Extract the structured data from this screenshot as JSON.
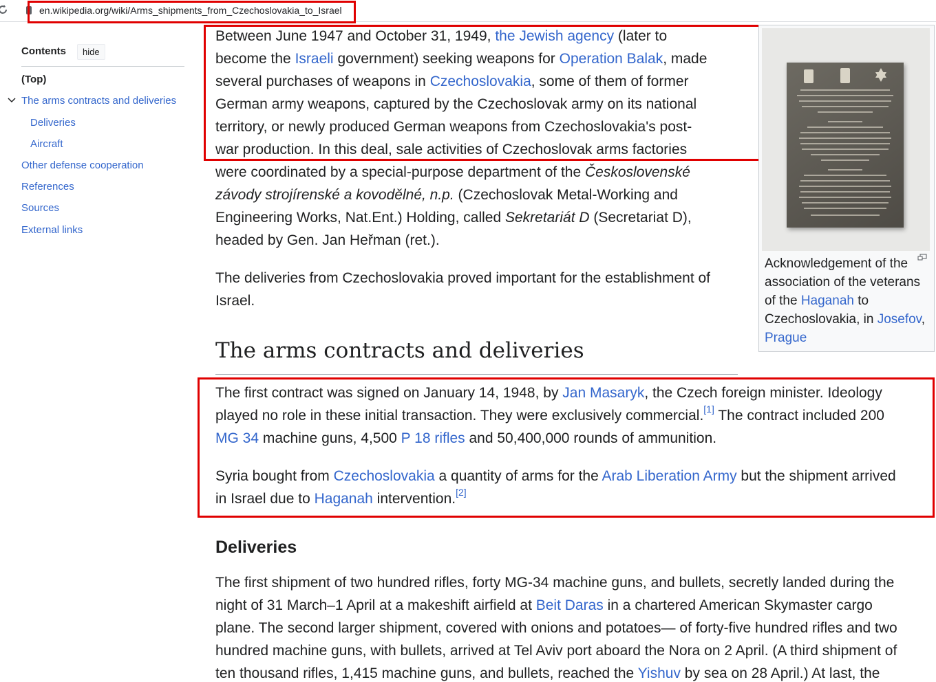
{
  "browser": {
    "url": "en.wikipedia.org/wiki/Arms_shipments_from_Czechoslovakia_to_Israel"
  },
  "toc": {
    "title": "Contents",
    "hide_label": "hide",
    "items": [
      {
        "label": "(Top)"
      },
      {
        "label": "The arms contracts and deliveries"
      },
      {
        "label": "Deliveries"
      },
      {
        "label": "Aircraft"
      },
      {
        "label": "Other defense cooperation"
      },
      {
        "label": "References"
      },
      {
        "label": "Sources"
      },
      {
        "label": "External links"
      }
    ]
  },
  "intro": {
    "l1a": "Between June 1947 and October 31, 1949, ",
    "l1_link": "the Jewish agency",
    "l1b": " (later to",
    "l2a": "become the ",
    "l2_link1": "Israeli",
    "l2b": " government) seeking weapons for ",
    "l2_link2": "Operation Balak",
    "l2c": ", made",
    "l3a": "several purchases of weapons in ",
    "l3_link": "Czechoslovakia",
    "l3b": ", some of them of former",
    "l4": "German army weapons, captured by the Czechoslovak army on its national",
    "l5": "territory, or newly produced German weapons from Czechoslovakia's post-",
    "l6": "war production. In this deal, sale activities of Czechoslovak arms factories",
    "l7a": "were coordinated by a special-purpose department of the ",
    "l7_italic": "Československé",
    "l8_italic": "závody strojírenské a kovodělné, n.p.",
    "l8b": " (Czechoslovak Metal-Working and",
    "l9a": "Engineering Works, Nat.Ent.) Holding, called ",
    "l9_italic": "Sekretariát D",
    "l9b": " (Secretariat D),",
    "l10": "headed by Gen. Jan Heřman (ret.).",
    "p2_l1": "The deliveries from Czechoslovakia proved important for the establishment of",
    "p2_l2": "Israel."
  },
  "section_arms": {
    "heading": "The arms contracts and deliveries",
    "p1_l1a": "The first contract was signed on January 14, 1948, by ",
    "p1_l1_link": "Jan Masaryk",
    "p1_l1b": ", the Czech foreign minister. Ideology",
    "p1_l2a": "played no role in these initial transaction. They were exclusively commercial.",
    "p1_l2_ref": "[1]",
    "p1_l2b": " The contract included 200",
    "p1_l3_link1": "MG 34",
    "p1_l3a": " machine guns, 4,500 ",
    "p1_l3_link2": "P 18 rifles",
    "p1_l3b": " and 50,400,000 rounds of ammunition.",
    "p2_l1a": "Syria bought from ",
    "p2_l1_link1": "Czechoslovakia",
    "p2_l1b": " a quantity of arms for the ",
    "p2_l1_link2": "Arab Liberation Army",
    "p2_l1c": " but the shipment arrived",
    "p2_l2a": "in Israel due to ",
    "p2_l2_link": "Haganah",
    "p2_l2b": " intervention.",
    "p2_l2_ref": "[2]"
  },
  "section_deliveries": {
    "heading": "Deliveries",
    "l1": "The first shipment of two hundred rifles, forty MG-34 machine guns, and bullets, secretly landed during the",
    "l2a": "night of 31 March–1 April at a makeshift airfield at ",
    "l2_link": "Beit Daras",
    "l2b": " in a chartered American Skymaster cargo",
    "l3": "plane. The second larger shipment, covered with onions and potatoes— of forty-five hundred rifles and two",
    "l4": "hundred machine guns, with bullets, arrived at Tel Aviv port aboard the Nora on 2 April. (A third shipment of",
    "l5a": "ten thousand rifles, 1,415 machine guns, and bullets, reached the ",
    "l5_link": "Yishuv",
    "l5b": " by sea on 28 April.) At last, the"
  },
  "figure": {
    "caption_a": "Acknowledgement of the association of the veterans of the ",
    "caption_link1": "Haganah",
    "caption_b": " to Czechoslovakia, in ",
    "caption_link2": "Josefov",
    "caption_c": ", ",
    "caption_link3": "Prague"
  }
}
